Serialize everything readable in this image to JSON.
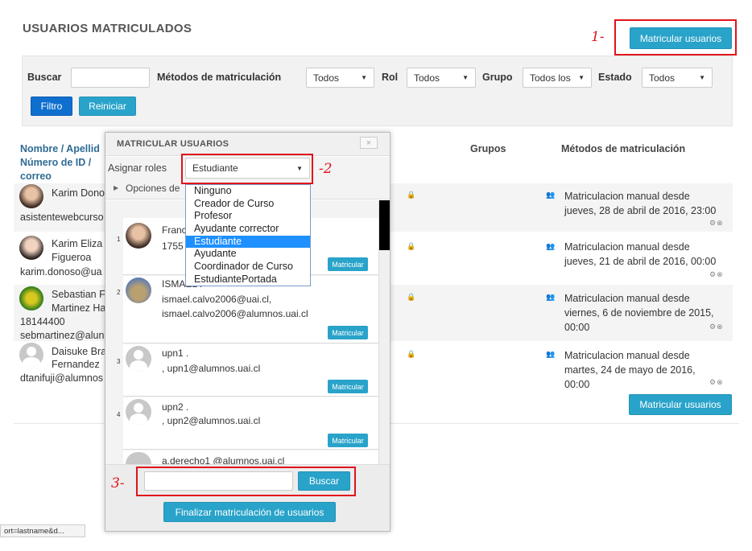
{
  "page": {
    "title": "USUARIOS MATRICULADOS",
    "enrol_button": "Matricular usuarios",
    "enrol_button_bottom": "Matricular usuarios"
  },
  "annotations": {
    "a1": "1-",
    "a2": "-2",
    "a3": "3-"
  },
  "filters": {
    "search_label": "Buscar",
    "methods_label": "Métodos de matriculación",
    "methods_value": "Todos",
    "role_label": "Rol",
    "role_value": "Todos",
    "group_label": "Grupo",
    "group_value": "Todos los",
    "state_label": "Estado",
    "state_value": "Todos",
    "filter_button": "Filtro",
    "reset_button": "Reiniciar"
  },
  "table": {
    "headers": {
      "name_line1": "Nombre / Apellid",
      "name_line2": "Número de ID /",
      "name_line3": "correo",
      "groups": "Grupos",
      "methods": "Métodos de matriculación"
    },
    "rows": [
      {
        "name1": "Karim Dono",
        "name2": "",
        "email": "asistentewebcurso",
        "method1": "Matriculacion manual desde",
        "method2": "jueves, 28 de abril de 2016, 23:00",
        "method3": ""
      },
      {
        "name1": "Karim Eliza",
        "name2": "Figueroa",
        "email": "karim.donoso@ua",
        "method1": "Matriculacion manual desde",
        "method2": "jueves, 21 de abril de 2016, 00:00",
        "method3": ""
      },
      {
        "name1": "Sebastian F",
        "name2": "Martinez Ha",
        "id": "18144400",
        "email": "sebmartinez@alun",
        "method1": "Matriculacion manual desde",
        "method2": "viernes, 6 de noviembre de 2015,",
        "method3": "00:00"
      },
      {
        "name1": "Daisuke Bra",
        "name2": "Fernandez",
        "email": "dtanifuji@alumnos",
        "method1": "Matriculacion manual desde",
        "method2": "martes, 24 de mayo de 2016,",
        "method3": "00:00"
      }
    ]
  },
  "modal": {
    "title": "MATRICULAR USUARIOS",
    "close": "×",
    "assign_roles_label": "Asignar roles",
    "role_selected": "Estudiante",
    "options_label": "Opciones de",
    "role_options": [
      "Ninguno",
      "Creador de Curso",
      "Profesor",
      "Ayudante corrector",
      "Estudiante",
      "Ayudante",
      "Coordinador de Curso",
      "EstudiantePortada"
    ],
    "users": [
      {
        "num": "1",
        "line1": "Franc",
        "line2": "1755",
        "line3": "",
        "button": "Matricular"
      },
      {
        "num": "2",
        "line1": "ISMAEL .",
        "line2": "ismael.calvo2006@uai.cl,",
        "line3": "ismael.calvo2006@alumnos.uai.cl",
        "button": "Matricular"
      },
      {
        "num": "3",
        "line1": "upn1 .",
        "line2": ", upn1@alumnos.uai.cl",
        "line3": "",
        "button": "Matricular"
      },
      {
        "num": "4",
        "line1": "upn2 .",
        "line2": ", upn2@alumnos.uai.cl",
        "line3": "",
        "button": "Matricular"
      },
      {
        "num": "",
        "line1": "a.derecho1 @alumnos.uai.cl",
        "line2": "",
        "line3": "",
        "button": ""
      }
    ],
    "search_button": "Buscar",
    "finish_button": "Finalizar matriculación de usuarios"
  },
  "status_bar": "ort=lastname&d..."
}
